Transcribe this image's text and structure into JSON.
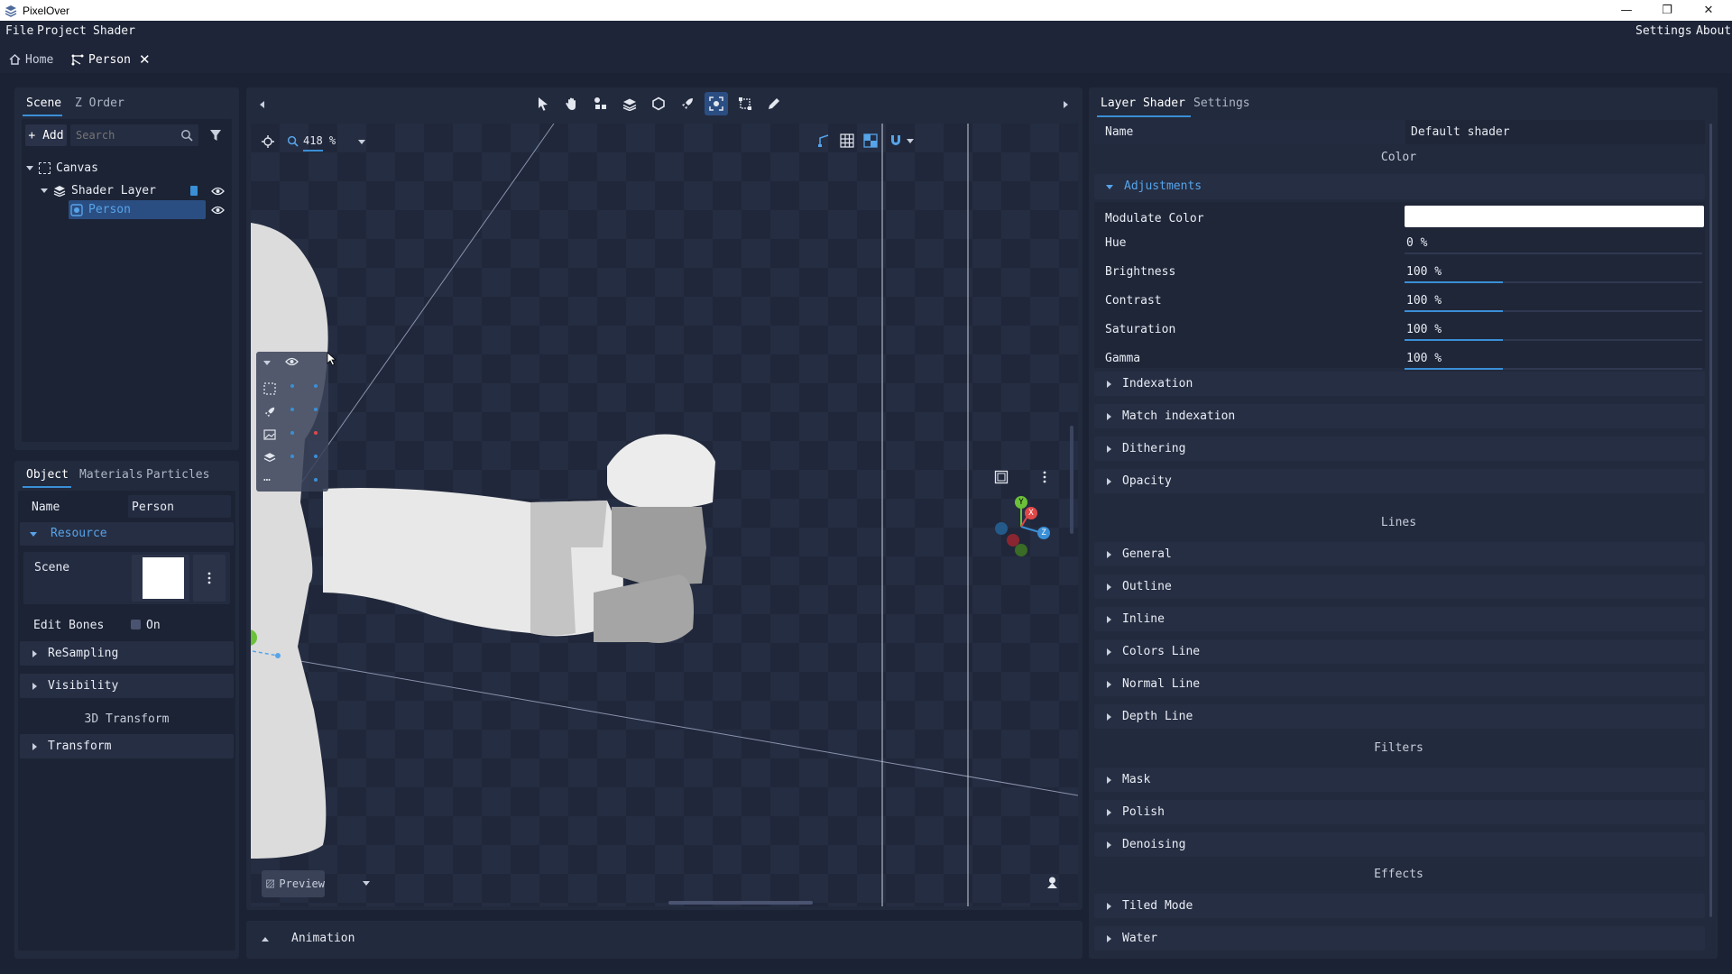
{
  "window": {
    "title": "PixelOver",
    "minimize": "—",
    "maximize": "❐",
    "close": "✕"
  },
  "menu": {
    "file": "File",
    "project": "Project",
    "shader": "Shader",
    "settings": "Settings",
    "about": "About"
  },
  "doc_tabs": {
    "home": "Home",
    "person": "Person",
    "close": "✕"
  },
  "scene_panel": {
    "tabs": [
      "Scene",
      "Z Order"
    ],
    "add_label": "+ Add",
    "search_placeholder": "Search",
    "tree": {
      "canvas": "Canvas",
      "shader_layer": "Shader Layer",
      "person": "Person"
    }
  },
  "object_panel": {
    "tabs": [
      "Object",
      "Materials",
      "Particles"
    ],
    "name_label": "Name",
    "name_value": "Person",
    "resource_label": "Resource",
    "scene_label": "Scene",
    "edit_bones_label": "Edit Bones",
    "edit_bones_value": "On",
    "resampling": "ReSampling",
    "visibility": "Visibility",
    "transform_3d": "3D Transform",
    "transform": "Transform"
  },
  "viewport": {
    "zoom": "418 %",
    "preview_label": "Preview",
    "gizmo": {
      "y": "Y",
      "x": "X",
      "z": "Z"
    }
  },
  "animation_panel": {
    "label": "Animation"
  },
  "shader_panel": {
    "tabs": [
      "Layer Shader",
      "Settings"
    ],
    "name_label": "Name",
    "name_value": "Default shader",
    "color_header": "Color",
    "adjustments_label": "Adjustments",
    "modulate_color_label": "Modulate Color",
    "modulate_color_value": "#ffffff",
    "props": [
      {
        "label": "Hue",
        "value": "0 %",
        "fill": 0.0
      },
      {
        "label": "Brightness",
        "value": "100 %",
        "fill": 0.33
      },
      {
        "label": "Contrast",
        "value": "100 %",
        "fill": 0.33
      },
      {
        "label": "Saturation",
        "value": "100 %",
        "fill": 0.33
      },
      {
        "label": "Gamma",
        "value": "100 %",
        "fill": 0.33
      }
    ],
    "color_sections": [
      "Indexation",
      "Match indexation",
      "Dithering",
      "Opacity"
    ],
    "lines_header": "Lines",
    "lines_sections": [
      "General",
      "Outline",
      "Inline",
      "Colors Line",
      "Normal Line",
      "Depth Line"
    ],
    "filters_header": "Filters",
    "filters_sections": [
      "Mask",
      "Polish",
      "Denoising"
    ],
    "effects_header": "Effects",
    "effects_sections": [
      "Tiled Mode",
      "Water"
    ]
  },
  "colors": {
    "accent": "#3a8fd6",
    "accent_text": "#56a4ea",
    "selection": "#2b4e82"
  }
}
